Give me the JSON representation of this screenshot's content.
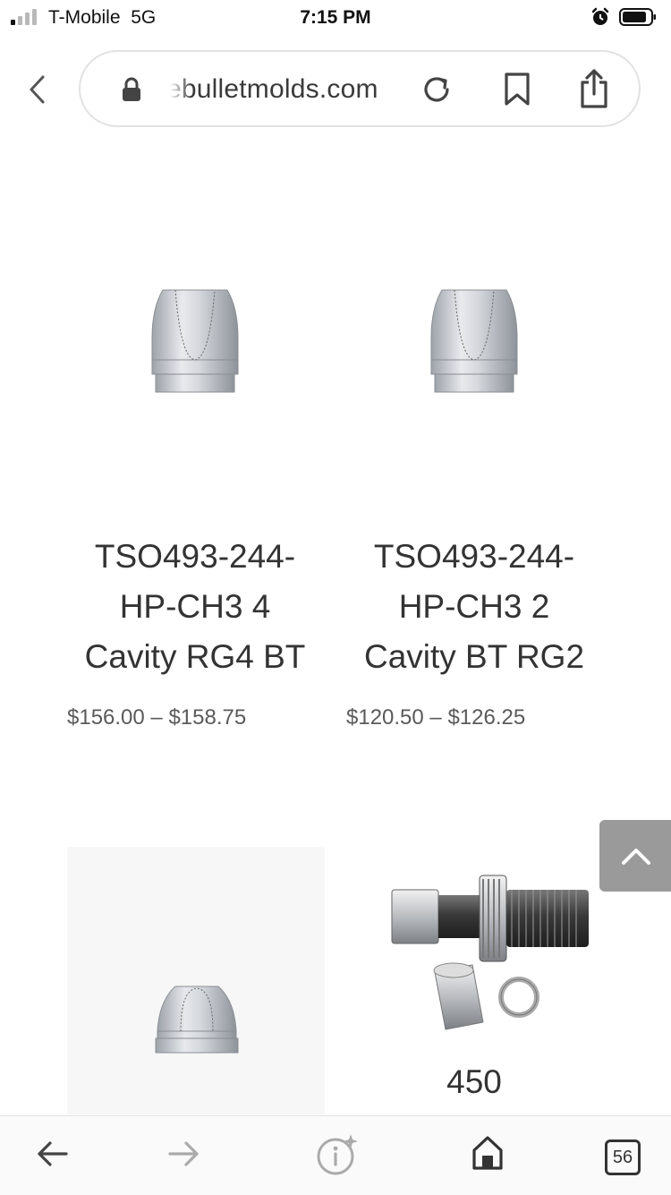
{
  "status_bar": {
    "carrier": "T-Mobile",
    "network": "5G",
    "time": "7:15 PM"
  },
  "browser": {
    "url_text": "ebulletmolds.com",
    "tab_count": "56"
  },
  "products": [
    {
      "title_lines": [
        "TSO493-244-",
        "HP-CH3 4",
        "Cavity RG4 BT"
      ],
      "price": "$156.00 – $158.75",
      "image": "bullet-image"
    },
    {
      "title_lines": [
        "TSO493-244-",
        "HP-CH3 2",
        "Cavity BT RG2"
      ],
      "price": "$120.50 – $126.25",
      "image": "bullet-image"
    },
    {
      "title_lines": [],
      "price": "",
      "image": "bullet-image"
    },
    {
      "title_lines": [
        "450"
      ],
      "price": "",
      "image": "sizing-die-image"
    }
  ],
  "icons": {
    "back": "chevron-left-icon",
    "lock": "lock-icon",
    "reload": "reload-icon",
    "bookmark": "bookmark-icon",
    "share": "share-icon",
    "scroll_top": "chevron-up-icon",
    "nav_back": "arrow-left-icon",
    "nav_forward": "arrow-right-icon",
    "info": "info-icon",
    "home": "home-icon",
    "tabs": "tabs-icon"
  },
  "colors": {
    "scroll_button": "#9a9a9a",
    "text": "#333333",
    "price": "#5a5a5a"
  }
}
